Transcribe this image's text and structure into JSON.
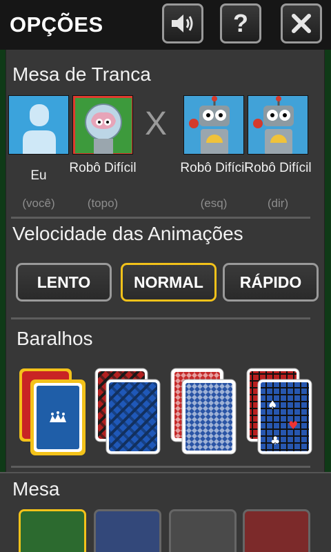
{
  "header": {
    "title": "OPÇÕES",
    "sound_icon": "speaker-icon",
    "help_label": "?",
    "close_icon": "close-icon"
  },
  "table_section": {
    "title": "Mesa de Tranca",
    "vs": "X",
    "players": [
      {
        "name": "Eu",
        "position": "(você)",
        "avatar": "user-avatar-icon"
      },
      {
        "name": "Robô Difícil",
        "position": "(topo)",
        "avatar": "robot-brain-icon"
      },
      {
        "name": "Robô Difícil",
        "position": "(esq)",
        "avatar": "robot-icon"
      },
      {
        "name": "Robô Difícil",
        "position": "(dir)",
        "avatar": "robot-icon"
      }
    ]
  },
  "speed_section": {
    "title": "Velocidade das Animações",
    "options": [
      "LENTO",
      "NORMAL",
      "RÁPIDO"
    ],
    "selected": "NORMAL"
  },
  "decks_section": {
    "title": "Baralhos",
    "decks": [
      "joker-deck",
      "plaid-deck",
      "diamond-pattern-deck",
      "suits-grid-deck"
    ],
    "selected_index": 0
  },
  "felt_section": {
    "title": "Mesa",
    "colors": [
      "#2c6a2f",
      "#33487a",
      "#4a4a4a",
      "#7c2a2a"
    ],
    "selected_index": 0
  },
  "colors": {
    "accent_selected": "#f3c21a",
    "panel": "#373737"
  }
}
